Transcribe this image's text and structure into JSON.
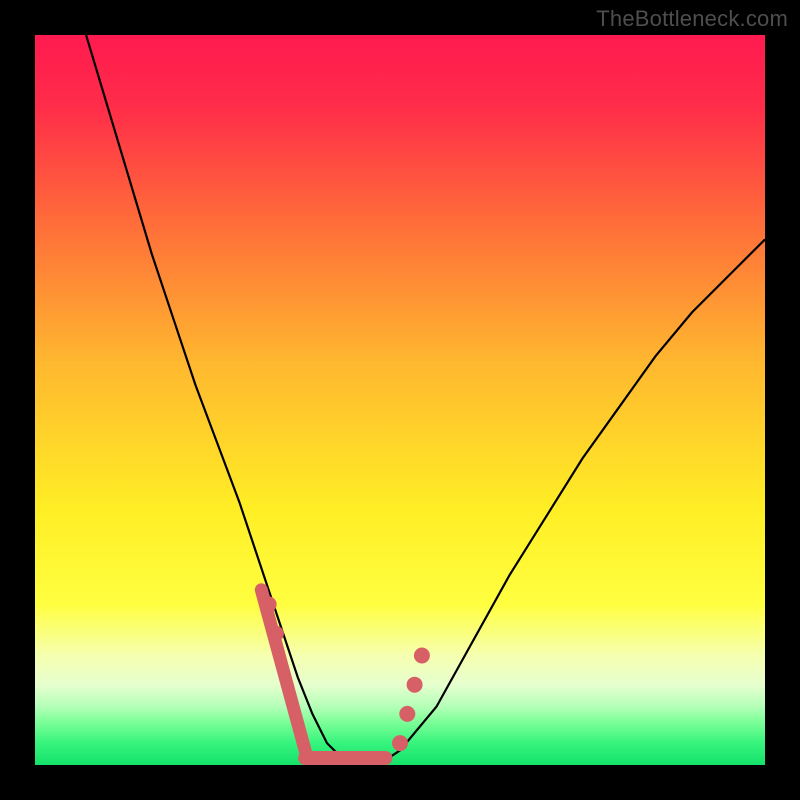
{
  "watermark": {
    "text": "TheBottleneck.com"
  },
  "gradient": {
    "stops": [
      {
        "offset": 0.0,
        "color": "#ff1a4f"
      },
      {
        "offset": 0.1,
        "color": "#ff2d49"
      },
      {
        "offset": 0.25,
        "color": "#ff6a3a"
      },
      {
        "offset": 0.45,
        "color": "#ffb82f"
      },
      {
        "offset": 0.65,
        "color": "#ffee25"
      },
      {
        "offset": 0.78,
        "color": "#ffff40"
      },
      {
        "offset": 0.85,
        "color": "#f6ffb0"
      },
      {
        "offset": 0.89,
        "color": "#e6ffce"
      },
      {
        "offset": 0.92,
        "color": "#b4ffb8"
      },
      {
        "offset": 0.94,
        "color": "#7fff99"
      },
      {
        "offset": 0.97,
        "color": "#36f47d"
      },
      {
        "offset": 1.0,
        "color": "#14e26a"
      }
    ]
  },
  "chart_data": {
    "type": "line",
    "title": "",
    "xlabel": "",
    "ylabel": "",
    "xlim": [
      0,
      100
    ],
    "ylim": [
      0,
      100
    ],
    "series": [
      {
        "name": "bottleneck-curve",
        "x": [
          7,
          10,
          13,
          16,
          19,
          22,
          25,
          28,
          30,
          32,
          34,
          36,
          38,
          40,
          42,
          44,
          47,
          50,
          55,
          60,
          65,
          70,
          75,
          80,
          85,
          90,
          95,
          100
        ],
        "y": [
          100,
          90,
          80,
          70,
          61,
          52,
          44,
          36,
          30,
          24,
          18,
          12,
          7,
          3,
          1,
          0,
          0,
          2,
          8,
          17,
          26,
          34,
          42,
          49,
          56,
          62,
          67,
          72
        ]
      }
    ],
    "markers": {
      "name": "highlight-dots",
      "color": "#d66066",
      "points": [
        {
          "x": 32,
          "y": 22
        },
        {
          "x": 33,
          "y": 18
        },
        {
          "x": 50,
          "y": 3
        },
        {
          "x": 51,
          "y": 7
        },
        {
          "x": 52,
          "y": 11
        },
        {
          "x": 53,
          "y": 15
        }
      ],
      "bottom_bar": {
        "x0": 37,
        "x1": 48,
        "y": 0
      }
    }
  }
}
